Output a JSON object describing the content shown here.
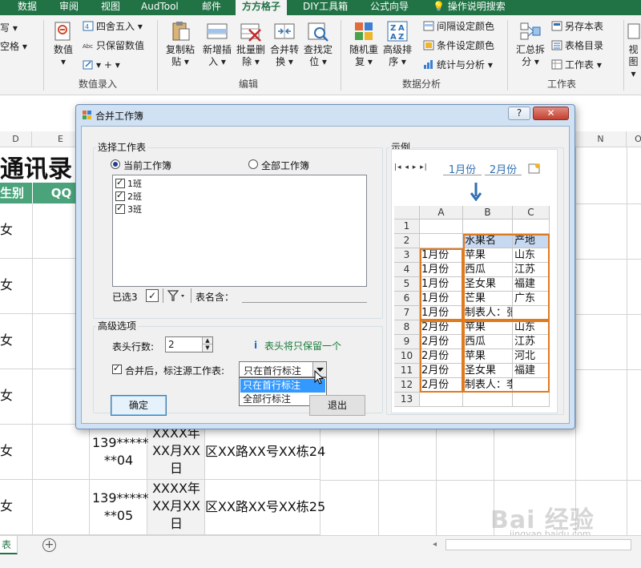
{
  "ribbon": {
    "tabs": [
      "数据",
      "审阅",
      "视图",
      "AudTool",
      "邮件",
      "方方格子",
      "DIY工具箱",
      "公式向导",
      "操作说明搜索"
    ],
    "active_tab": "方方格子",
    "left_items": [
      "写 ▾",
      "空格 ▾"
    ],
    "numeric_group": {
      "label": "数值录入",
      "number_btn": "数值",
      "round_btn": "四舍五入 ▾",
      "keep_value_btn": "只保留数值",
      "misc": "▾ + ▾"
    },
    "edit_group": {
      "label": "编辑",
      "copy_paste": [
        "复制粘",
        "贴 ▾"
      ],
      "new_insert": [
        "新增插",
        "入 ▾"
      ],
      "batch_delete": [
        "批量删",
        "除 ▾"
      ],
      "merge_convert": [
        "合并转",
        "换 ▾"
      ],
      "find_locate": [
        "查找定",
        "位 ▾"
      ]
    },
    "analysis_group": {
      "label": "数据分析",
      "random_repeat": [
        "随机重",
        "复 ▾"
      ],
      "advanced_sort": [
        "高级排",
        "序 ▾"
      ],
      "interval_color": "间隔设定颜色",
      "cond_color": "条件设定颜色",
      "stats": "统计与分析 ▾"
    },
    "workbook_group": {
      "label": "工作表",
      "summary_split": [
        "汇总拆",
        "分 ▾"
      ],
      "save_as": "另存本表",
      "sheet_index": "表格目录",
      "worksheet": "工作表 ▾",
      "view": [
        "视",
        "图 ▾"
      ]
    }
  },
  "sheet": {
    "col_letters": [
      "D",
      "E",
      "N",
      "O"
    ],
    "title_fragment": "通讯录",
    "header_cells": [
      "生别",
      "QQ"
    ],
    "gender_values": [
      "女",
      "女",
      "女",
      "女",
      "女",
      "女"
    ],
    "row_phone": [
      [
        "139*****",
        "**04"
      ],
      [
        "139*****",
        "**05"
      ]
    ],
    "row_date": [
      [
        "XXXX年",
        "XX月XX",
        "日"
      ],
      [
        "XXXX年",
        "XX月XX",
        "日"
      ]
    ],
    "row_address": [
      "区XX路XX号XX栋24",
      "区XX路XX号XX栋25"
    ],
    "sheet_tab": "表"
  },
  "dialog": {
    "title": "合并工作簿",
    "help_label": "?",
    "close_label": "✕",
    "select_group_label": "选择工作表",
    "radio_current": "当前工作簿",
    "radio_all": "全部工作簿",
    "sheets": [
      "1班",
      "2班",
      "3班"
    ],
    "selected_count": "已选3",
    "table_name_label": "表名含：",
    "adv_group_label": "高级选项",
    "header_rows_label": "表头行数:",
    "header_rows_value": "2",
    "info_note": "表头将只保留一个",
    "merge_mark_label": "合并后，标注源工作表:",
    "combo_value": "只在首行标注",
    "combo_options": [
      "只在首行标注",
      "全部行标注"
    ],
    "ok_label": "确定",
    "exit_label": "退出",
    "example_group_label": "示例",
    "example_tabs": [
      "1月份",
      "2月份"
    ],
    "example_cols": [
      "A",
      "B",
      "C"
    ],
    "example_rows": [
      [
        "1",
        "",
        "",
        ""
      ],
      [
        "2",
        "",
        "水果名",
        "产地"
      ],
      [
        "3",
        "1月份",
        "苹果",
        "山东"
      ],
      [
        "4",
        "1月份",
        "西瓜",
        "江苏"
      ],
      [
        "5",
        "1月份",
        "圣女果",
        "福建"
      ],
      [
        "6",
        "1月份",
        "芒果",
        "广东"
      ],
      [
        "7",
        "1月份",
        "制表人：张伟",
        ""
      ],
      [
        "8",
        "2月份",
        "苹果",
        "山东"
      ],
      [
        "9",
        "2月份",
        "西瓜",
        "江苏"
      ],
      [
        "10",
        "2月份",
        "苹果",
        "河北"
      ],
      [
        "11",
        "2月份",
        "圣女果",
        "福建"
      ],
      [
        "12",
        "2月份",
        "制表人：李四",
        ""
      ],
      [
        "13",
        "",
        "",
        ""
      ]
    ]
  },
  "watermark": {
    "brand": "Bai 经验",
    "url": "jingyan.baidu.com"
  },
  "colors": {
    "excel_green": "#217346",
    "header_green": "#4aa37a",
    "dialog_frame": "#cfe1f3",
    "highlight_orange": "#e07a1f",
    "selection_blue": "#3399ff"
  }
}
